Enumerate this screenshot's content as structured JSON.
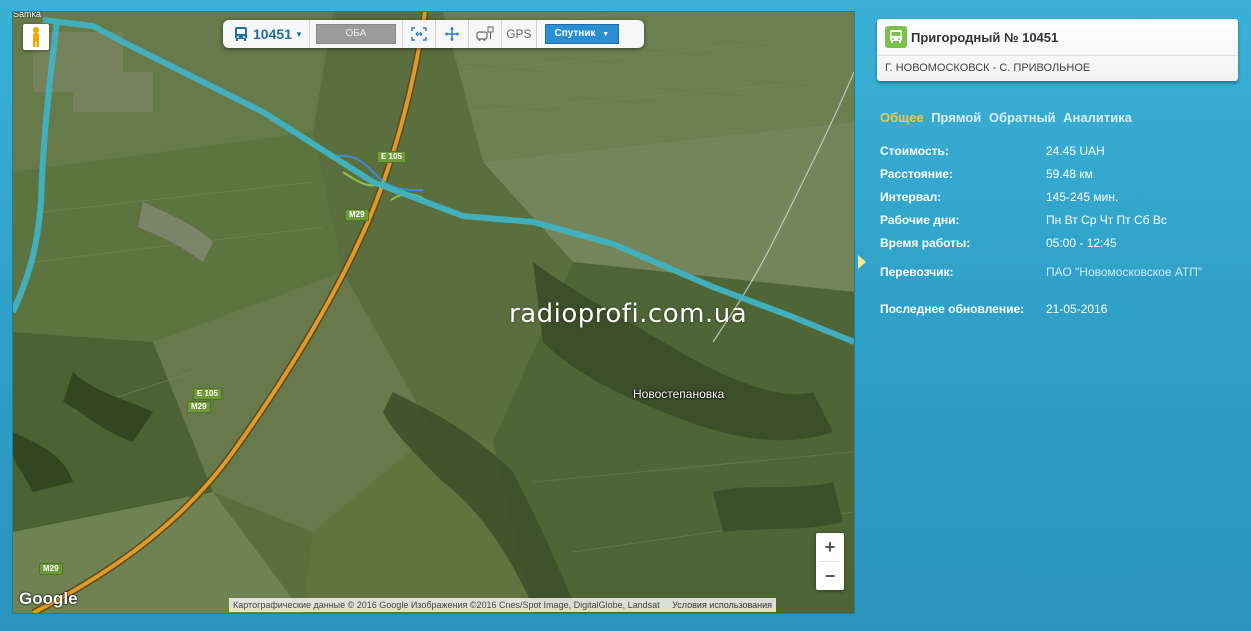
{
  "map": {
    "corner_label": "Samka",
    "watermark": "radioprofi.com.ua",
    "place_label": "Новостепановка",
    "road_labels": [
      "E 105",
      "M29",
      "E 105",
      "M29",
      "M29"
    ],
    "google_logo": "Google",
    "attribution": "Картографические данные © 2016 Google Изображения ©2016 Cnes/Spot Image, DigitalGlobe, Landsat",
    "terms_link": "Условия использования",
    "zoom_in": "+",
    "zoom_out": "−"
  },
  "toolbar": {
    "route_number": "10451",
    "direction_select": "ОБА",
    "gps_label": "GPS",
    "maptype_select": "Спутник"
  },
  "route": {
    "title": "Пригородный № 10451",
    "subtitle": "Г. НОВОМОСКОВСК - С. ПРИВОЛЬНОЕ"
  },
  "tabs": [
    {
      "label": "Общее"
    },
    {
      "label": "Прямой"
    },
    {
      "label": "Обратный"
    },
    {
      "label": "Аналитика"
    }
  ],
  "info": [
    {
      "label": "Стоимость:",
      "value": "24.45 UAH"
    },
    {
      "label": "Расстояние:",
      "value": "59.48 км"
    },
    {
      "label": "Интервал:",
      "value": "145-245 мин."
    },
    {
      "label": "Рабочие дни:",
      "value": "Пн Вт Ср Чт Пт Сб Вс"
    },
    {
      "label": "Время работы:",
      "value": "05:00 - 12:45"
    },
    {
      "label": "Перевозчик:",
      "value": "ПАО \"Новомосковское АТП\""
    },
    {
      "label": "Последнее обновление:",
      "value": "21-05-2016"
    }
  ],
  "colors": {
    "route_line": "#3fb3c3",
    "highway": "#e09a2a",
    "accent_tab": "#f4c542",
    "bus_icon_bg": "#7cc24a"
  }
}
